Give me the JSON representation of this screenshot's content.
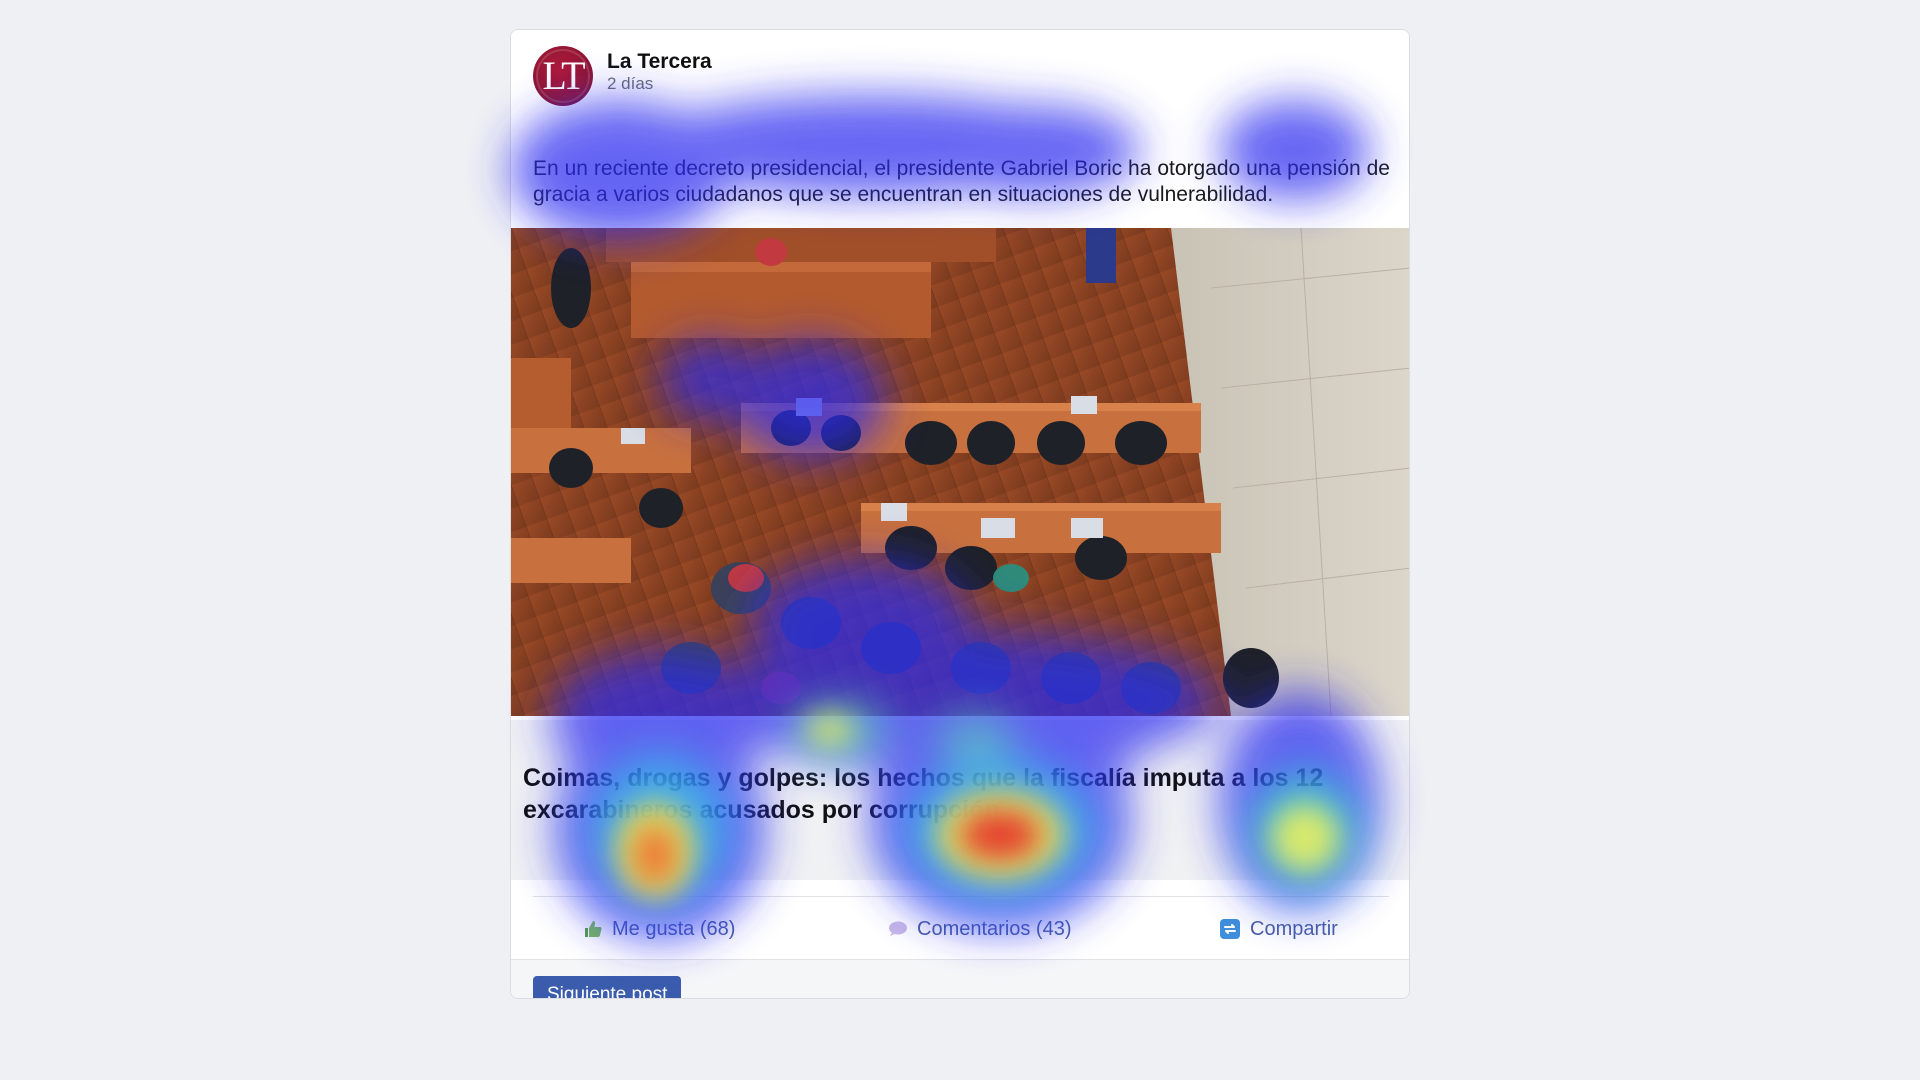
{
  "post": {
    "page_name": "La Tercera",
    "time": "2 días",
    "avatar_initials": "LT",
    "text": "En un reciente decreto presidencial, el presidente Gabriel Boric ha otorgado una pensión de gracia a varios ciudadanos que se encuentran en situaciones de vulnerabilidad.",
    "image_icon": "courtroom-photo",
    "link_title": "Coimas, drogas y golpes: los hechos que la fiscalía imputa a los 12 excarabineros acusados por corrupción"
  },
  "actions": {
    "like_label": "Me gusta (68)",
    "comment_label": "Comentarios (43)",
    "share_label": "Compartir",
    "like_icon": "thumbs-up-icon",
    "comment_icon": "speech-bubble-icon",
    "share_icon": "share-icon"
  },
  "footer": {
    "next_label": "Siguiente post"
  },
  "colors": {
    "background": "#eff0f4",
    "card": "#ffffff",
    "action_text": "#4a5fa6",
    "button": "#3b5cad",
    "avatar": "#9a1a38"
  }
}
